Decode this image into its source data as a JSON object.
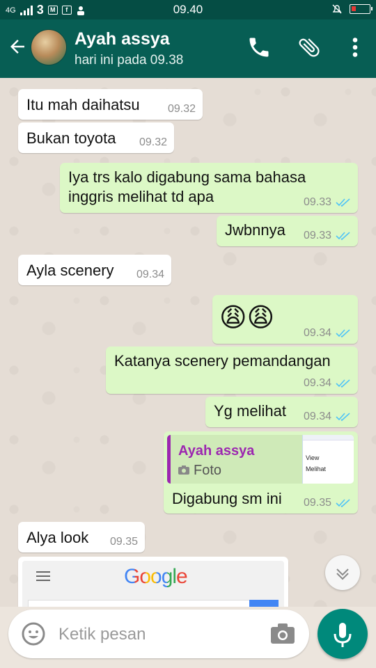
{
  "status_bar": {
    "time": "09.40",
    "network": "4G",
    "carrier": "3"
  },
  "header": {
    "contact_name": "Ayah assya",
    "last_seen": "hari ini pada 09.38"
  },
  "messages": [
    {
      "direction": "in",
      "text": "Itu mah daihatsu",
      "time": "09.32"
    },
    {
      "direction": "in",
      "text": "Bukan toyota",
      "time": "09.32"
    },
    {
      "direction": "out",
      "lines": [
        "Iya trs kalo digabung sama bahasa",
        "inggris melihat td apa"
      ],
      "time": "09.33"
    },
    {
      "direction": "out",
      "text": "Jwbnnya",
      "time": "09.33"
    },
    {
      "direction": "in",
      "text": "Ayla scenery",
      "time": "09.34"
    },
    {
      "direction": "out",
      "text": "😩😩",
      "time": "09.34"
    },
    {
      "direction": "out",
      "text": "Katanya scenery pemandangan",
      "time": "09.34"
    },
    {
      "direction": "out",
      "text": "Yg melihat",
      "time": "09.34"
    },
    {
      "direction": "out",
      "quote": {
        "author": "Ayah assya",
        "type": "Foto",
        "thumb_lines": [
          "View",
          "Melihat"
        ]
      },
      "text": "Digabung sm ini",
      "time": "09.35"
    },
    {
      "direction": "in",
      "text": "Alya look",
      "time": "09.35"
    },
    {
      "direction": "in",
      "type": "image",
      "preview_logo": "Google"
    }
  ],
  "composer": {
    "placeholder": "Ketik pesan"
  },
  "icons": {
    "back": "arrow-back-icon",
    "call": "phone-icon",
    "attach": "paperclip-icon",
    "menu": "more-vert-icon",
    "emoji": "emoji-icon",
    "camera": "camera-icon",
    "mic": "mic-icon",
    "scroll": "chevron-down-icon"
  },
  "colors": {
    "header": "#075e54",
    "status_bar": "#054d44",
    "outgoing_bubble": "#dcf8c6",
    "incoming_bubble": "#ffffff",
    "read_ticks": "#4fc3f7",
    "quote_author": "#9c27b0",
    "fab": "#00897b"
  }
}
